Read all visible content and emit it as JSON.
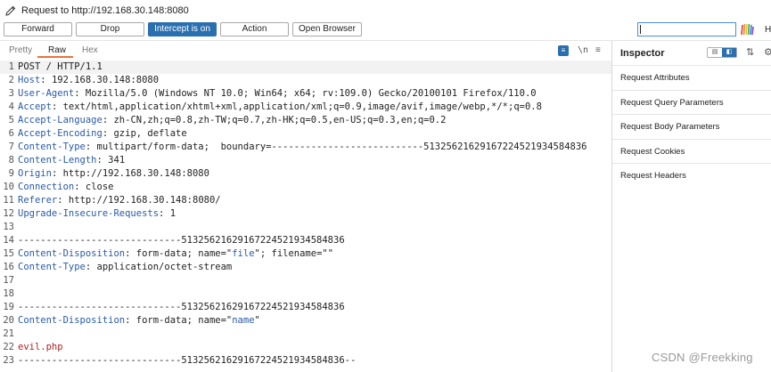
{
  "header": {
    "title": "Request to http://192.168.30.148:8080"
  },
  "toolbar": {
    "forward_label": "Forward",
    "drop_label": "Drop",
    "intercept_label": "Intercept is on",
    "action_label": "Action",
    "open_browser_label": "Open Browser",
    "search_value": "",
    "help_label": "H",
    "accent_color": "#2a6fb0"
  },
  "tabs": {
    "pretty": "Pretty",
    "raw": "Raw",
    "hex": "Hex",
    "ln_icon": "\\n",
    "menu_icon": "≡",
    "active_tab_color": "#e8743b"
  },
  "editor": {
    "lines": [
      {
        "n": "1",
        "key": "",
        "sep": "",
        "val": "POST / HTTP/1.1"
      },
      {
        "n": "2",
        "key": "Host",
        "sep": ": ",
        "val": "192.168.30.148:8080"
      },
      {
        "n": "3",
        "key": "User-Agent",
        "sep": ": ",
        "val": "Mozilla/5.0 (Windows NT 10.0; Win64; x64; rv:109.0) Gecko/20100101 Firefox/110.0"
      },
      {
        "n": "4",
        "key": "Accept",
        "sep": ": ",
        "val": "text/html,application/xhtml+xml,application/xml;q=0.9,image/avif,image/webp,*/*;q=0.8"
      },
      {
        "n": "5",
        "key": "Accept-Language",
        "sep": ": ",
        "val": "zh-CN,zh;q=0.8,zh-TW;q=0.7,zh-HK;q=0.5,en-US;q=0.3,en;q=0.2"
      },
      {
        "n": "6",
        "key": "Accept-Encoding",
        "sep": ": ",
        "val": "gzip, deflate"
      },
      {
        "n": "7",
        "key": "Content-Type",
        "sep": ": ",
        "val": "multipart/form-data;  boundary=---------------------------51325621629167224521934584836"
      },
      {
        "n": "8",
        "key": "Content-Length",
        "sep": ": ",
        "val": "341"
      },
      {
        "n": "9",
        "key": "Origin",
        "sep": ": ",
        "val": "http://192.168.30.148:8080"
      },
      {
        "n": "10",
        "key": "Connection",
        "sep": ": ",
        "val": "close"
      },
      {
        "n": "11",
        "key": "Referer",
        "sep": ": ",
        "val": "http://192.168.30.148:8080/"
      },
      {
        "n": "12",
        "key": "Upgrade-Insecure-Requests",
        "sep": ": ",
        "val": "1"
      },
      {
        "n": "13",
        "key": "",
        "sep": "",
        "val": ""
      },
      {
        "n": "14",
        "key": "",
        "sep": "",
        "val": "-----------------------------51325621629167224521934584836"
      },
      {
        "n": "15",
        "key": "Content-Disposition",
        "sep": ": ",
        "val": "form-data; name=\"file\"; filename=\"\""
      },
      {
        "n": "16",
        "key": "Content-Type",
        "sep": ": ",
        "val": "application/octet-stream"
      },
      {
        "n": "17",
        "key": "",
        "sep": "",
        "val": ""
      },
      {
        "n": "18",
        "key": "",
        "sep": "",
        "val": ""
      },
      {
        "n": "19",
        "key": "",
        "sep": "",
        "val": "-----------------------------51325621629167224521934584836"
      },
      {
        "n": "20",
        "key": "Content-Disposition",
        "sep": ": ",
        "val": "form-data; name=\"name\""
      },
      {
        "n": "21",
        "key": "",
        "sep": "",
        "val": ""
      },
      {
        "n": "22",
        "key": "",
        "sep": "",
        "val": "evil.php",
        "red": true
      },
      {
        "n": "23",
        "key": "",
        "sep": "",
        "val": "-----------------------------51325621629167224521934584836--"
      }
    ]
  },
  "inspector": {
    "title": "Inspector",
    "sections": [
      "Request Attributes",
      "Request Query Parameters",
      "Request Body Parameters",
      "Request Cookies",
      "Request Headers"
    ]
  },
  "watermark": "CSDN @Freekking"
}
